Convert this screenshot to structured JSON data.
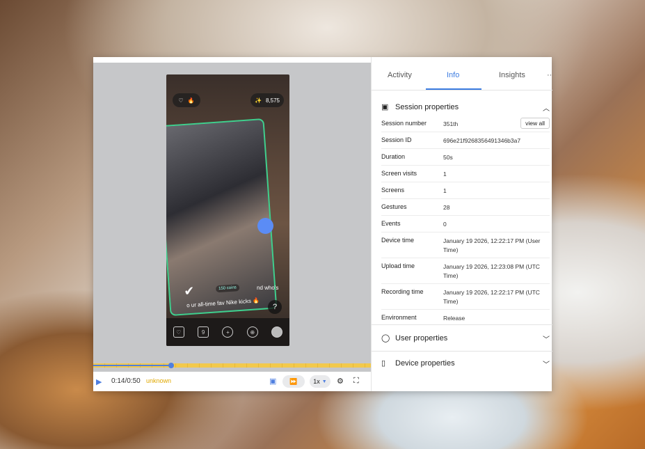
{
  "player": {
    "like_count": "8,575",
    "coins_label": "150 coins",
    "caption": "o ur all-time fav Nike kicks 🔥",
    "side_text": "nd who's",
    "help": "?",
    "nav_badge": "9",
    "current_time": "0:14/0:50",
    "status": "unknown",
    "speed": "1x",
    "progress_fraction": 0.28
  },
  "tabs": [
    {
      "label": "Activity"
    },
    {
      "label": "Info",
      "active": true
    },
    {
      "label": "Insights"
    },
    {
      "label": "··"
    }
  ],
  "session": {
    "title": "Session properties",
    "view_all_label": "view all",
    "rows": [
      {
        "key": "Session number",
        "value": "351th"
      },
      {
        "key": "Session ID",
        "value": "696e21f9268356491346b3a7"
      },
      {
        "key": "Duration",
        "value": "50s"
      },
      {
        "key": "Screen visits",
        "value": "1"
      },
      {
        "key": "Screens",
        "value": "1"
      },
      {
        "key": "Gestures",
        "value": "28"
      },
      {
        "key": "Events",
        "value": "0"
      },
      {
        "key": "Device time",
        "value": "January 19 2026, 12:22:17 PM (User Time)"
      },
      {
        "key": "Upload time",
        "value": "January 19 2026, 12:23:08 PM (UTC Time)"
      },
      {
        "key": "Recording time",
        "value": "January 19 2026, 12:22:17 PM (UTC Time)"
      },
      {
        "key": "Environment",
        "value": "Release"
      }
    ]
  },
  "user_properties": {
    "title": "User properties"
  },
  "device_properties": {
    "title": "Device properties"
  },
  "colors": {
    "accent": "#3b7be0",
    "timeline": "#f2c94c",
    "touch": "#5b8cf5"
  }
}
